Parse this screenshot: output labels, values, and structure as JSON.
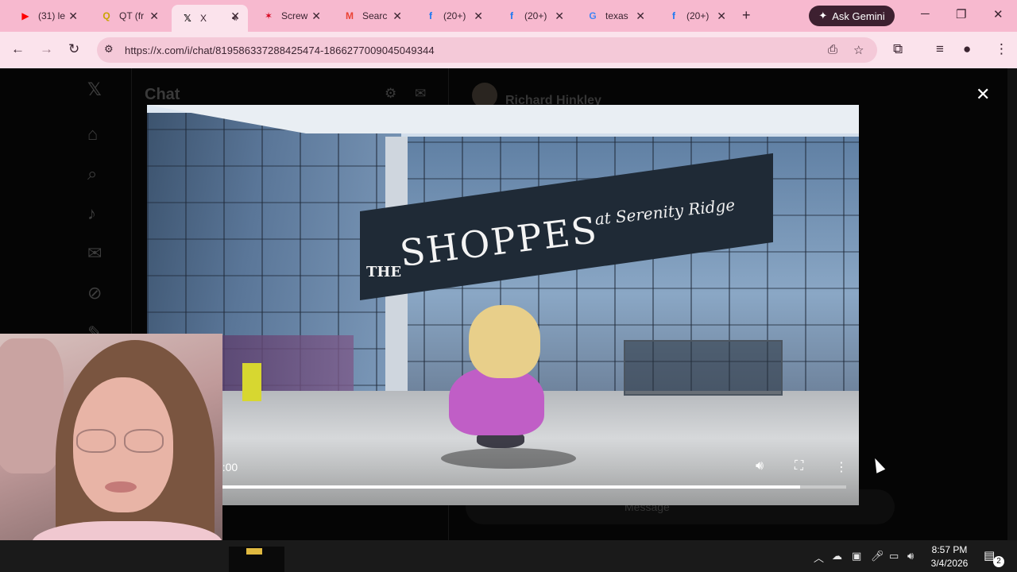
{
  "browser": {
    "tabs": [
      {
        "icon": "youtube-icon",
        "title": "(31) le",
        "color": "#ff0000"
      },
      {
        "icon": "qt-icon",
        "title": "QT (fr",
        "color": "#c8a400"
      },
      {
        "icon": "x-icon",
        "title": "X",
        "color": "#000000"
      },
      {
        "icon": "screwfix-icon",
        "title": "Screw",
        "color": "#d6001c"
      },
      {
        "icon": "gmail-icon",
        "title": "Searc",
        "color": "#ea4335"
      },
      {
        "icon": "facebook-icon",
        "title": "(20+)",
        "color": "#1877f2"
      },
      {
        "icon": "facebook-icon",
        "title": "(20+)",
        "color": "#1877f2"
      },
      {
        "icon": "google-icon",
        "title": "texas",
        "color": "#4285f4"
      },
      {
        "icon": "facebook-icon",
        "title": "(20+)",
        "color": "#1877f2"
      }
    ],
    "gemini_label": "Ask Gemini",
    "url": "https://x.com/i/chat/819586337288425474-1866277009045049344"
  },
  "page": {
    "chat_title": "Chat",
    "convo_name": "Richard Hinkley",
    "message_placeholder": "Message"
  },
  "video": {
    "sign_the": "THE",
    "sign_main": "SHOPPES",
    "sign_sub": "at Serenity Ridge",
    "time": "0:01 / 1:00",
    "progress": 0.93
  },
  "taskbar": {
    "time": "8:57 PM",
    "date": "3/4/2026",
    "notifications": "2"
  },
  "colors": {
    "tabbar": "#f7b9cf",
    "toolbar": "#fbe3ec",
    "gemini_bg": "#3d2030"
  }
}
